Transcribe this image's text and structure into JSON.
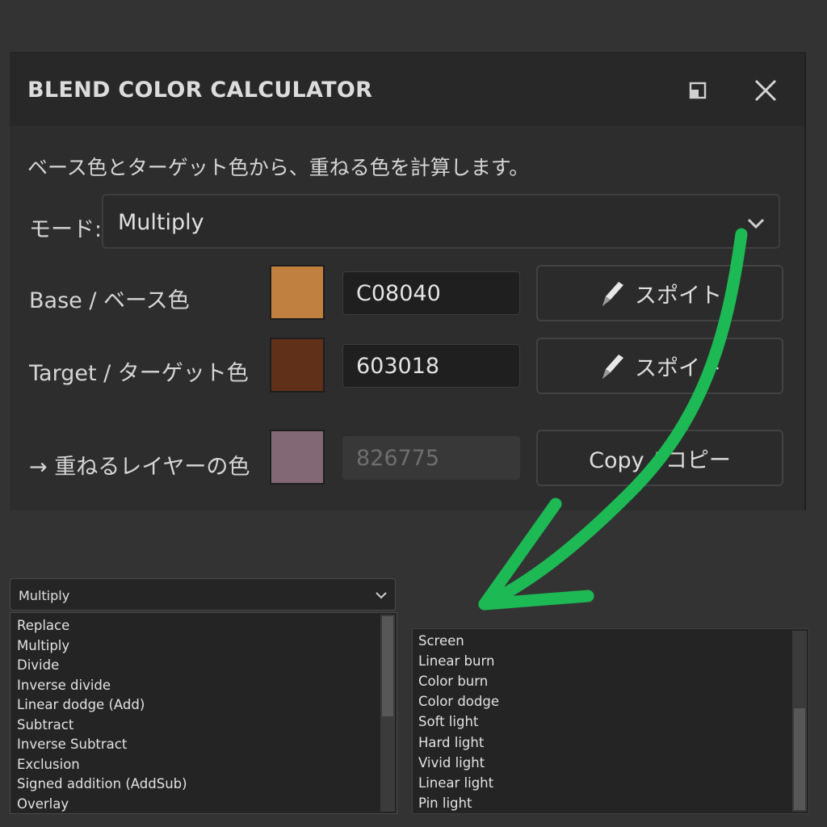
{
  "dialog": {
    "title": "BLEND COLOR CALCULATOR",
    "description": "ベース色とターゲット色から、重ねる色を計算します。",
    "mode_label": "モード:",
    "mode_value": "Multiply",
    "base_label": "Base / ベース色",
    "base_hex": "C08040",
    "base_color": "#C08040",
    "target_label": "Target / ターゲット色",
    "target_hex": "603018",
    "target_color": "#603018",
    "result_label": "→ 重ねるレイヤーの色",
    "result_hex": "826775",
    "result_color": "#826775",
    "eyedropper_label": "スポイト",
    "copy_label": "Copy / コピー"
  },
  "dropdown_a": {
    "selected": "Multiply",
    "items": [
      "Replace",
      "Multiply",
      "Divide",
      "Inverse divide",
      "Linear dodge (Add)",
      "Subtract",
      "Inverse Subtract",
      "Exclusion",
      "Signed addition (AddSub)",
      "Overlay"
    ]
  },
  "dropdown_b": {
    "items": [
      "Screen",
      "Linear burn",
      "Color burn",
      "Color dodge",
      "Soft light",
      "Hard light",
      "Vivid light",
      "Linear light",
      "Pin light"
    ]
  },
  "colors": {
    "annotation_arrow": "#1DB954"
  },
  "icons": {
    "restore": "restore-window-icon",
    "close": "close-icon",
    "chevron": "chevron-down-icon",
    "eyedropper": "eyedropper-icon"
  }
}
